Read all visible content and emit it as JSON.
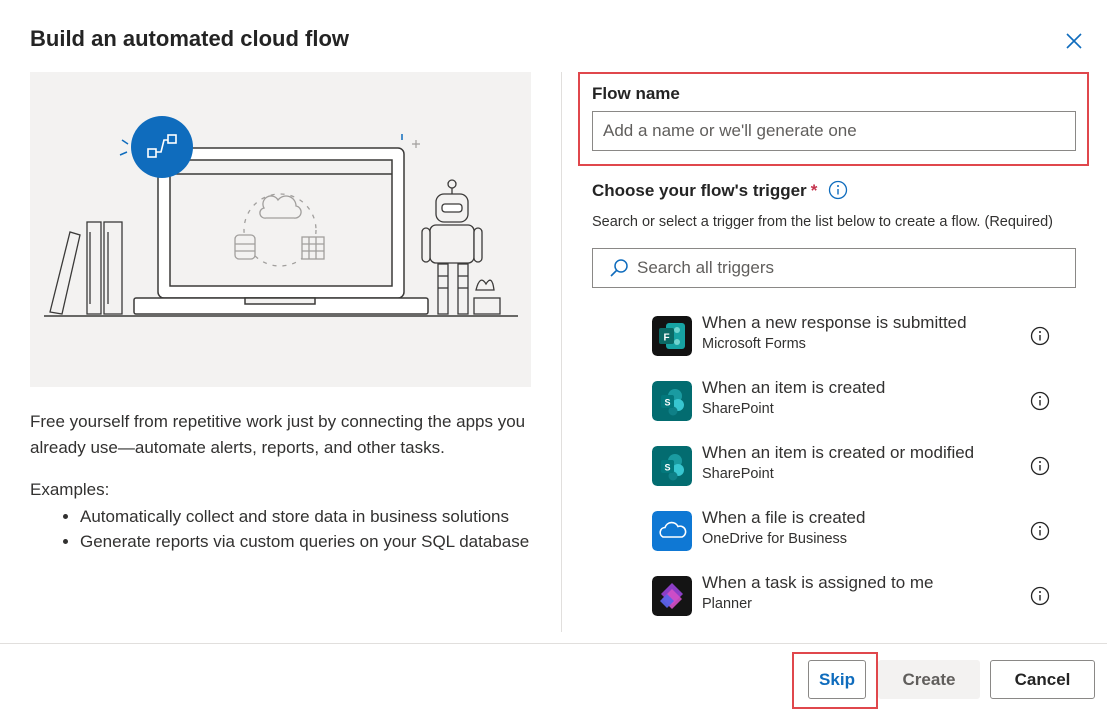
{
  "dialog": {
    "title": "Build an automated cloud flow",
    "description": "Free yourself from repetitive work just by connecting the apps you already use—automate alerts, reports, and other tasks.",
    "examples_title": "Examples:",
    "examples": [
      "Automatically collect and store data in business solutions",
      "Generate reports via custom queries on your SQL database"
    ]
  },
  "flow_name": {
    "label": "Flow name",
    "placeholder": "Add a name or we'll generate one",
    "value": ""
  },
  "trigger": {
    "label": "Choose your flow's trigger",
    "required_mark": "*",
    "hint": "Search or select a trigger from the list below to create a flow. (Required)",
    "search_placeholder": "Search all triggers",
    "items": [
      {
        "title": "When a new response is submitted",
        "app": "Microsoft Forms",
        "icon": "forms-icon",
        "color": "#0f5c55"
      },
      {
        "title": "When an item is created",
        "app": "SharePoint",
        "icon": "sharepoint-icon",
        "color": "#036c70"
      },
      {
        "title": "When an item is created or modified",
        "app": "SharePoint",
        "icon": "sharepoint-icon",
        "color": "#036c70"
      },
      {
        "title": "When a file is created",
        "app": "OneDrive for Business",
        "icon": "onedrive-icon",
        "color": "#0f78d4"
      },
      {
        "title": "When a task is assigned to me",
        "app": "Planner",
        "icon": "planner-icon",
        "color": "#1b1a2e"
      }
    ]
  },
  "footer": {
    "skip": "Skip",
    "create": "Create",
    "cancel": "Cancel"
  },
  "colors": {
    "accent": "#0f6cbd",
    "highlight": "#e0474c",
    "illustration_bg": "#f3f2f1"
  }
}
